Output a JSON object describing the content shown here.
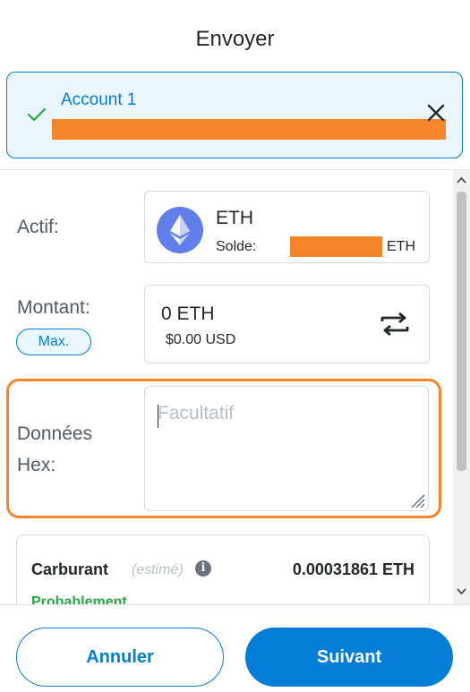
{
  "header": {
    "title": "Envoyer"
  },
  "recipient": {
    "name": "Account 1"
  },
  "asset": {
    "label": "Actif:",
    "symbol": "ETH",
    "balance_label": "Solde:",
    "balance_unit": "ETH"
  },
  "amount": {
    "label": "Montant:",
    "value": "0 ETH",
    "fiat": "$0.00 USD",
    "max_label": "Max."
  },
  "hex": {
    "label_line1": "Données",
    "label_line2": "Hex:",
    "placeholder": "Facultatif"
  },
  "gas": {
    "title": "Carburant",
    "estimated": "(estimé)",
    "info": "i",
    "amount": "0.00031861 ETH",
    "likelihood": "Probablement"
  },
  "footer": {
    "cancel_label": "Annuler",
    "next_label": "Suivant"
  },
  "colors": {
    "accent": "#037dd6",
    "highlight": "#f6852a",
    "success": "#28a745",
    "eth": "#627eea"
  },
  "icons": [
    "check-icon",
    "close-icon",
    "ethereum-icon",
    "swap-icon",
    "info-icon",
    "resize-handle-icon",
    "chevron-up-icon",
    "chevron-down-icon"
  ]
}
